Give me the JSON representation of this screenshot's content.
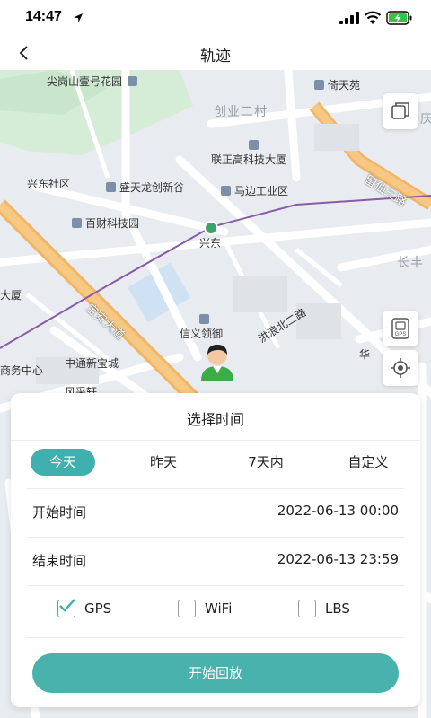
{
  "status_bar": {
    "time": "14:47",
    "icons": [
      "location-arrow-icon",
      "signal-icon",
      "wifi-icon",
      "battery-charging-icon"
    ]
  },
  "nav": {
    "back_icon": "chevron-left-icon",
    "title": "轨迹"
  },
  "map": {
    "labels": [
      "尖岗山壹号花园",
      "倚天苑",
      "创业二村",
      "庆",
      "联正高科技大厦",
      "兴东社区",
      "盛天龙创新谷",
      "马边工业区",
      "留仙三路",
      "百财科技园",
      "兴东",
      "长丰",
      "大厦",
      "宝安大道",
      "洪浪北二路",
      "信义领御",
      "华",
      "商务中心",
      "中通新宝城",
      "风采轩"
    ],
    "controls": {
      "layers_icon": "layers-icon",
      "gps_icon": "gps-device-icon",
      "gps_icon_text": "GPS",
      "locate_icon": "locate-crosshair-icon"
    },
    "marker_icon": "user-avatar-icon"
  },
  "sheet": {
    "title": "选择时间",
    "tabs": [
      {
        "label": "今天",
        "active": true
      },
      {
        "label": "昨天",
        "active": false
      },
      {
        "label": "7天内",
        "active": false
      },
      {
        "label": "自定义",
        "active": false
      }
    ],
    "start_time": {
      "label": "开始时间",
      "value": "2022-06-13 00:00"
    },
    "end_time": {
      "label": "结束时间",
      "value": "2022-06-13 23:59"
    },
    "options": [
      {
        "label": "GPS",
        "checked": true
      },
      {
        "label": "WiFi",
        "checked": false
      },
      {
        "label": "LBS",
        "checked": false
      }
    ],
    "start_button": "开始回放"
  },
  "colors": {
    "accent": "#3fb0ad",
    "button": "#49b2ac",
    "road_major": "#f3b96b",
    "metro_line": "#8a5aa8"
  }
}
